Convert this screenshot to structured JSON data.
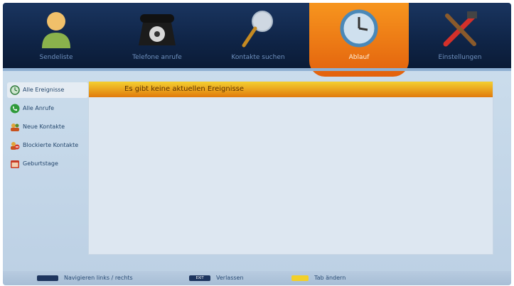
{
  "header": {
    "tabs": [
      {
        "label": "Sendeliste",
        "icon": "user-icon"
      },
      {
        "label": "Telefone anrufe",
        "icon": "phone-icon"
      },
      {
        "label": "Kontakte suchen",
        "icon": "search-icon"
      },
      {
        "label": "Ablauf",
        "icon": "clock-icon",
        "active": true
      },
      {
        "label": "Einstellungen",
        "icon": "tools-icon"
      }
    ]
  },
  "sidebar": {
    "items": [
      {
        "label": "Alle Ereignisse",
        "icon": "clock-icon"
      },
      {
        "label": "Alle Anrufe",
        "icon": "phone-icon"
      },
      {
        "label": "Neue Kontakte",
        "icon": "contacts-icon"
      },
      {
        "label": "Blockierte Kontakte",
        "icon": "blocked-contacts-icon"
      },
      {
        "label": "Geburtstage",
        "icon": "calendar-icon"
      }
    ]
  },
  "main": {
    "banner_text": "Es gibt keine aktuellen Ereignisse"
  },
  "footer": {
    "items": [
      {
        "key": "arrow-keys",
        "text": "Navigieren links / rechts"
      },
      {
        "key": "exit-key",
        "key_label": "EXIT",
        "text": "Verlassen"
      },
      {
        "key": "yellow-key",
        "text": "Tab ändern"
      }
    ]
  },
  "colors": {
    "topbar": "#0f2446",
    "active_tab": "#f08a1c",
    "content_bg": "#dde7f1",
    "banner": "#f0b020",
    "yellow_key": "#f2d02a"
  }
}
